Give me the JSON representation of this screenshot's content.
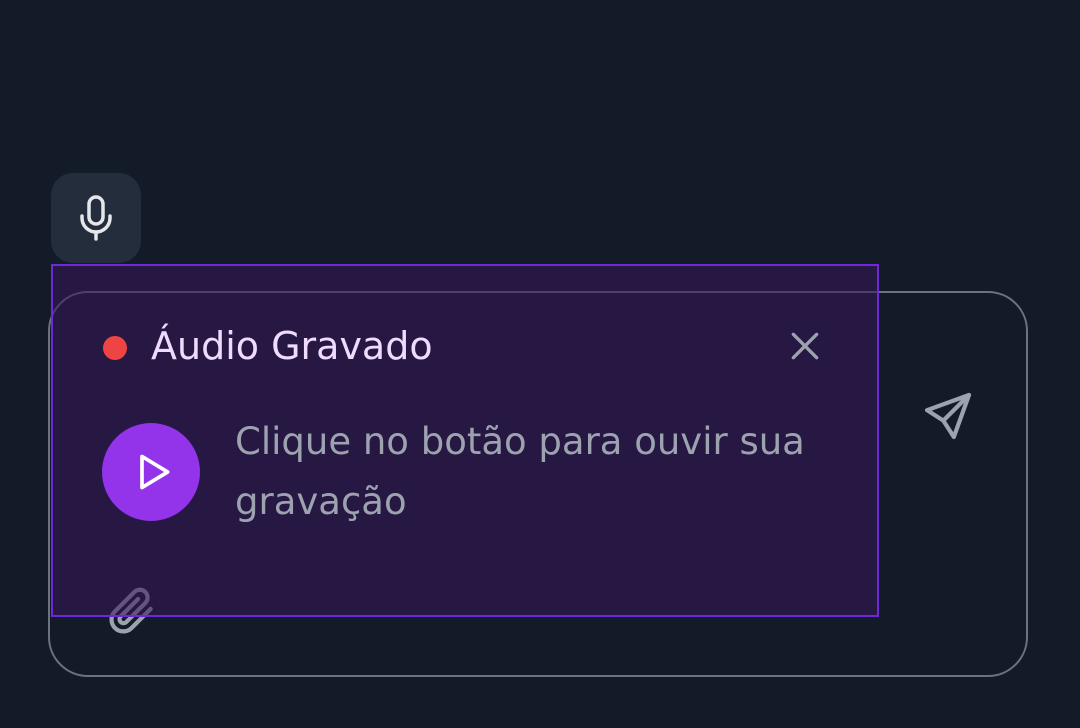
{
  "audio_panel": {
    "title": "Áudio Gravado",
    "hint": "Clique no botão para ouvir sua gravação"
  },
  "icons": {
    "mic": "microphone-icon",
    "close": "close-icon",
    "play": "play-icon",
    "send": "send-icon",
    "attach": "paperclip-icon"
  },
  "colors": {
    "background": "#131a28",
    "accent": "#9333ea",
    "panel_border": "#6d28d9",
    "recording_indicator": "#ef4444",
    "title_text": "#f0dbff",
    "muted_text": "#9ca3af"
  }
}
